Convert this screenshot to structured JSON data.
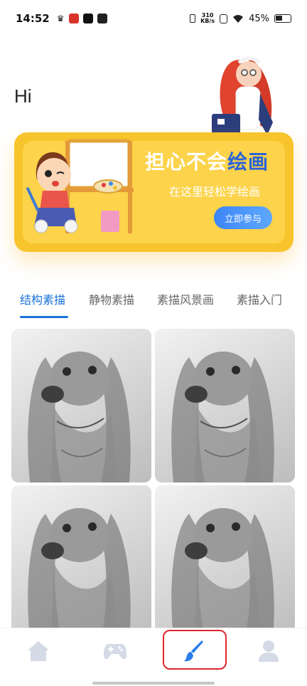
{
  "status_bar": {
    "time": "14:52",
    "net_speed_value": "310",
    "net_speed_unit": "KB/s",
    "battery_percent": "45%"
  },
  "greeting": "Hi",
  "banner": {
    "title_part1": "担心不会",
    "title_part2": "绘画",
    "subtitle": "在这里轻松学绘画",
    "button_label": "立即参与"
  },
  "tabs": [
    {
      "label": "结构素描",
      "active": true
    },
    {
      "label": "静物素描",
      "active": false
    },
    {
      "label": "素描风景画",
      "active": false
    },
    {
      "label": "素描入门",
      "active": false
    }
  ],
  "grid": {
    "image_subject": "pencil-sketch-dog",
    "count_visible": 4
  },
  "bottom_nav": {
    "items": [
      "home-icon",
      "gamepad-icon",
      "paintbrush-icon",
      "user-icon"
    ],
    "active_index": 2,
    "highlight_color": "#e0262d",
    "active_color": "#2b7de9",
    "inactive_color": "#d4dae6"
  }
}
